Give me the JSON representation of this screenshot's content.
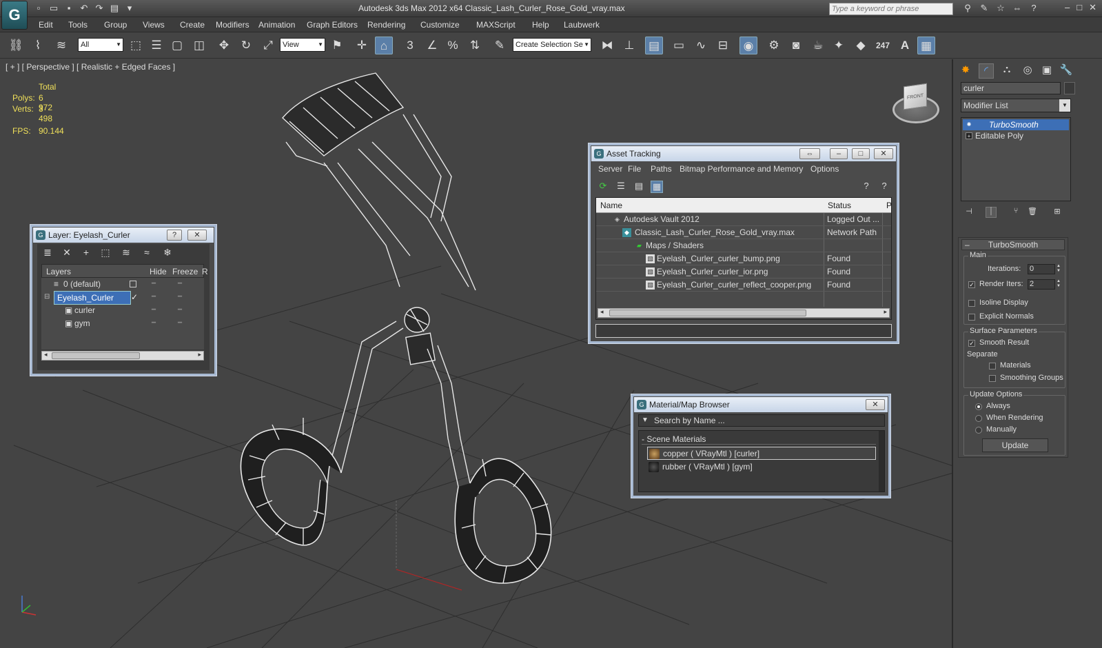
{
  "app": {
    "logo": "G",
    "title": "Autodesk 3ds Max  2012 x64      Classic_Lash_Curler_Rose_Gold_vray.max",
    "search_placeholder": "Type a keyword or phrase"
  },
  "menu": [
    "Edit",
    "Tools",
    "Group",
    "Views",
    "Create",
    "Modifiers",
    "Animation",
    "Graph Editors",
    "Rendering",
    "Customize",
    "MAXScript",
    "Help",
    "Laubwerk"
  ],
  "toolbar": {
    "selection_filter": "All",
    "ref_coord": "View",
    "named_selection": "Create Selection Se",
    "counter": "247",
    "snap_label": "3"
  },
  "viewport": {
    "label": "[ + ] [ Perspective ] [ Realistic + Edged Faces ]",
    "stats_header": "Total",
    "polys_label": "Polys:",
    "polys_value": "6 972",
    "verts_label": "Verts:",
    "verts_value": "3 498",
    "fps_label": "FPS:",
    "fps_value": "90.144",
    "viewcube_face": "FRONT"
  },
  "layer_panel": {
    "title": "Layer: Eyelash_Curler",
    "help_btn": "?",
    "close_btn": "✕",
    "col_layers": "Layers",
    "col_hide": "Hide",
    "col_freeze": "Freeze",
    "col_r": "R",
    "rows": [
      {
        "name": "0 (default)"
      },
      {
        "name": "Eyelash_Curler"
      },
      {
        "name": "curler"
      },
      {
        "name": "gym"
      }
    ]
  },
  "asset_panel": {
    "title": "Asset Tracking",
    "menu": [
      "Server",
      "File",
      "Paths",
      "Bitmap Performance and Memory",
      "Options"
    ],
    "col_name": "Name",
    "col_status": "Status",
    "col_p": "P",
    "rows": [
      {
        "name": "Autodesk Vault 2012",
        "status": "Logged Out ..."
      },
      {
        "name": "Classic_Lash_Curler_Rose_Gold_vray.max",
        "status": "Network Path"
      },
      {
        "name": "Maps / Shaders",
        "status": ""
      },
      {
        "name": "Eyelash_Curler_curler_bump.png",
        "status": "Found"
      },
      {
        "name": "Eyelash_Curler_curler_ior.png",
        "status": "Found"
      },
      {
        "name": "Eyelash_Curler_curler_reflect_cooper.png",
        "status": "Found"
      }
    ]
  },
  "material_panel": {
    "title": "Material/Map Browser",
    "search_placeholder": "Search by Name ...",
    "group": "- Scene Materials",
    "items": [
      {
        "name": "copper  ( VRayMtl )  [curler]",
        "color": "#8a6a3a"
      },
      {
        "name": "rubber  ( VRayMtl )  [gym]",
        "color": "#1e1e1e"
      }
    ]
  },
  "command_panel": {
    "object_name": "curler",
    "modifier_list": "Modifier List",
    "stack": [
      "TurboSmooth",
      "Editable Poly"
    ],
    "rollout_title": "TurboSmooth",
    "main_group": "Main",
    "iterations_label": "Iterations:",
    "iterations_value": "0",
    "render_iters_label": "Render Iters:",
    "render_iters_value": "2",
    "isoline_label": "Isoline Display",
    "explicit_normals_label": "Explicit Normals",
    "surface_group": "Surface Parameters",
    "smooth_result_label": "Smooth Result",
    "separate_label": "Separate",
    "materials_label": "Materials",
    "smoothing_groups_label": "Smoothing Groups",
    "update_group": "Update Options",
    "always_label": "Always",
    "when_rendering_label": "When Rendering",
    "manually_label": "Manually",
    "update_button": "Update"
  },
  "colors": {
    "selection_blue": "#3d6fb6",
    "stats_yellow": "#f0e05a",
    "panel_border": "#a7b9d2",
    "viewport_bg": "#444444"
  }
}
